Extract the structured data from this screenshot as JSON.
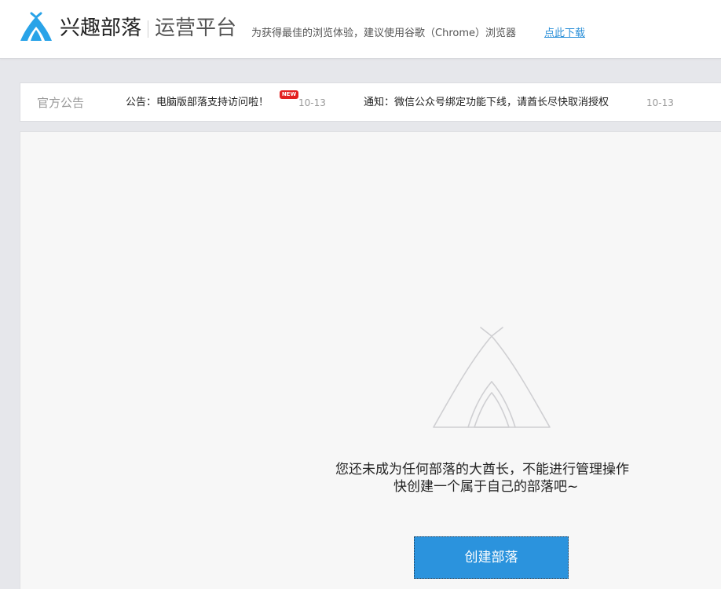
{
  "header": {
    "brand": "兴趣部落",
    "platform": "运营平台",
    "browser_tip": "为获得最佳的浏览体验，建议使用谷歌（Chrome）浏览器",
    "download_link": "点此下载"
  },
  "notices": {
    "label": "官方公告",
    "items": [
      {
        "title": "公告：电脑版部落支持访问啦！",
        "badge": "NEW",
        "date": "10-13"
      },
      {
        "title": "通知：微信公众号绑定功能下线，请酋长尽快取消授权",
        "date": "10-13"
      }
    ]
  },
  "empty_state": {
    "line1": "您还未成为任何部落的大酋长，不能进行管理操作",
    "line2": "快创建一个属于自己的部落吧~",
    "create_button": "创建部落"
  },
  "colors": {
    "brand_blue": "#2b93dd",
    "link_blue": "#2a8fd8",
    "badge_red": "#e32020"
  }
}
